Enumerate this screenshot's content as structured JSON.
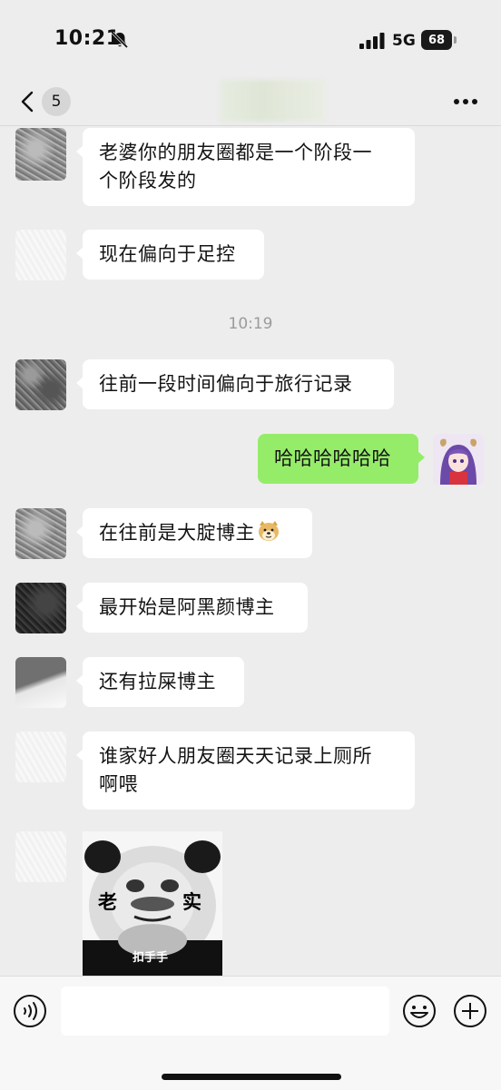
{
  "status_bar": {
    "time": "10:21",
    "network": "5G",
    "battery": "68",
    "icons": [
      "bell-muted-icon",
      "signal-icon",
      "battery-icon"
    ]
  },
  "nav": {
    "unread_count": "5",
    "icons": [
      "chevron-left-icon",
      "more-icon"
    ]
  },
  "messages": [
    {
      "side": "left",
      "lines": [
        "老婆你的朋友圈都是一个阶段一",
        "个阶段发的"
      ]
    },
    {
      "side": "left",
      "text": "现在偏向于足控"
    },
    {
      "type": "timestamp",
      "text": "10:19"
    },
    {
      "side": "left",
      "text": "往前一段时间偏向于旅行记录"
    },
    {
      "side": "right",
      "text": "哈哈哈哈哈哈"
    },
    {
      "side": "left",
      "text": "在往前是大腚博主",
      "emoji": "doge-icon"
    },
    {
      "side": "left",
      "text": "最开始是阿黑颜博主"
    },
    {
      "side": "left",
      "text": "还有拉屎博主"
    },
    {
      "side": "left",
      "lines": [
        "谁家好人朋友圈天天记录上厕所",
        "啊喂"
      ]
    },
    {
      "side": "left",
      "type": "sticker",
      "caption_left": "老",
      "caption_right": "实",
      "caption_bottom": "扣手手"
    }
  ],
  "input_bar": {
    "placeholder": "",
    "icons": [
      "voice-icon",
      "emoji-icon",
      "plus-icon"
    ]
  },
  "colors": {
    "background": "#ededed",
    "bubble_left": "#ffffff",
    "bubble_right": "#95ec69",
    "timestamp": "#9b9b9b"
  }
}
